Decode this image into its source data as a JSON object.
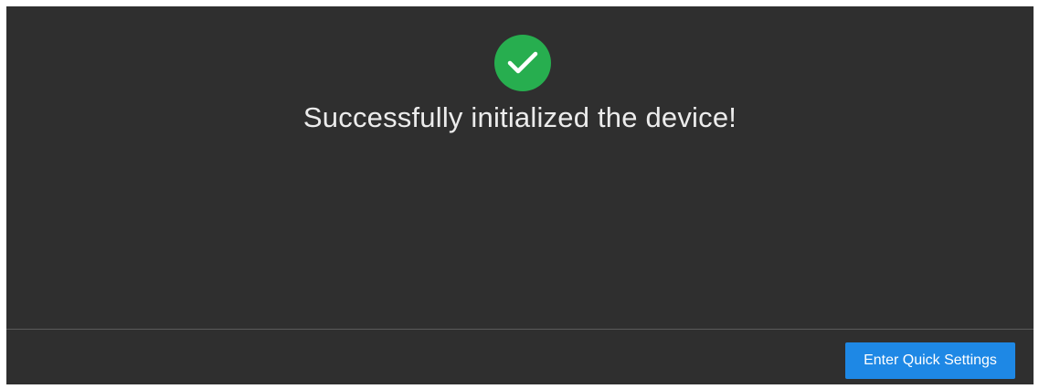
{
  "dialog": {
    "status_icon": "check-circle-icon",
    "message": "Successfully initialized the device!",
    "primary_button_label": "Enter Quick Settings"
  },
  "colors": {
    "background": "#2f2f2f",
    "success": "#27ae4f",
    "accent": "#1e88e5",
    "text": "#ececec"
  }
}
